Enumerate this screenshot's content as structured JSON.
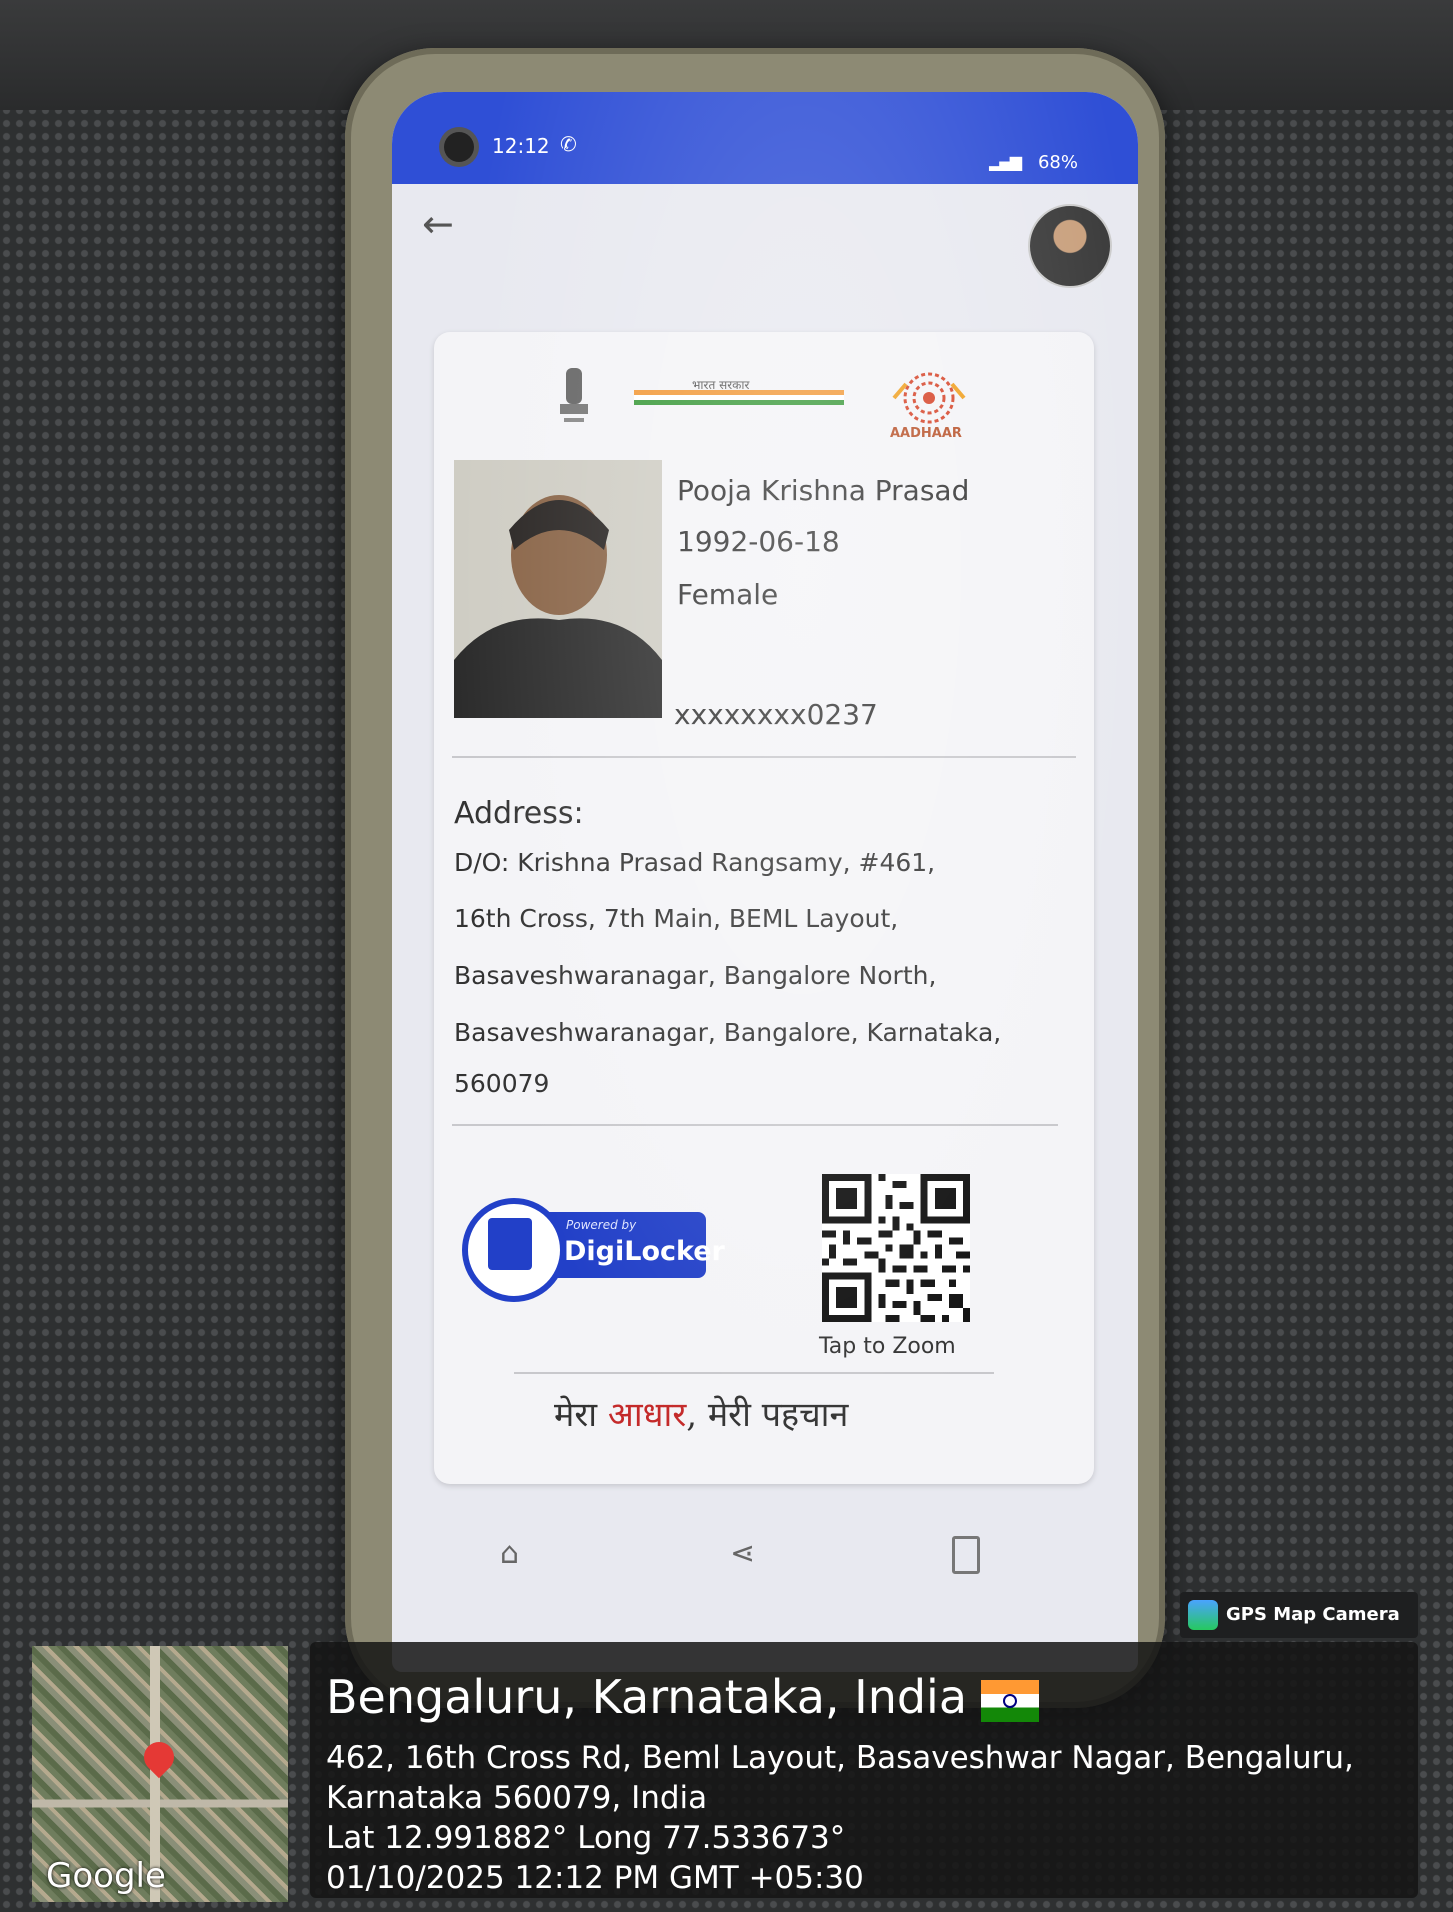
{
  "statusbar": {
    "time": "12:12",
    "battery": "68%"
  },
  "card": {
    "emblem_icon": "state-emblem-icon",
    "goi_text": "भारत सरकार",
    "logo_text": "AADHAAR",
    "name": "Pooja Krishna Prasad",
    "dob": "1992-06-18",
    "gender": "Female",
    "aadhaar_number": "xxxxxxxx0237",
    "address_title": "Address:",
    "address_lines": [
      "D/O: Krishna Prasad Rangsamy, #461,",
      "16th Cross, 7th Main, BEML Layout,",
      "Basaveshwaranagar, Bangalore North,",
      "Basaveshwaranagar, Bangalore, Karnataka,",
      "560079"
    ],
    "digilocker_small": "Powered by",
    "digilocker_big": "DigiLocker",
    "qr_caption": "Tap to Zoom",
    "tagline_a": "मेरा ",
    "tagline_hl": "आधार",
    "tagline_b": ", मेरी पहचान",
    "accent": "#2240c8",
    "highlight": "#c42a2a"
  },
  "nav": {
    "home_icon": "home-icon",
    "share_icon": "share-icon",
    "menu_icon": "menu-icon"
  },
  "gps": {
    "app_label": "GPS Map Camera",
    "city": "Bengaluru, Karnataka, India",
    "address_1": "462, 16th Cross Rd, Beml Layout, Basaveshwar Nagar, Bengaluru,",
    "address_2": "Karnataka 560079, India",
    "coords": "Lat 12.991882° Long 77.533673°",
    "datetime": "01/10/2025 12:12 PM GMT +05:30",
    "map_brand": "Google"
  }
}
